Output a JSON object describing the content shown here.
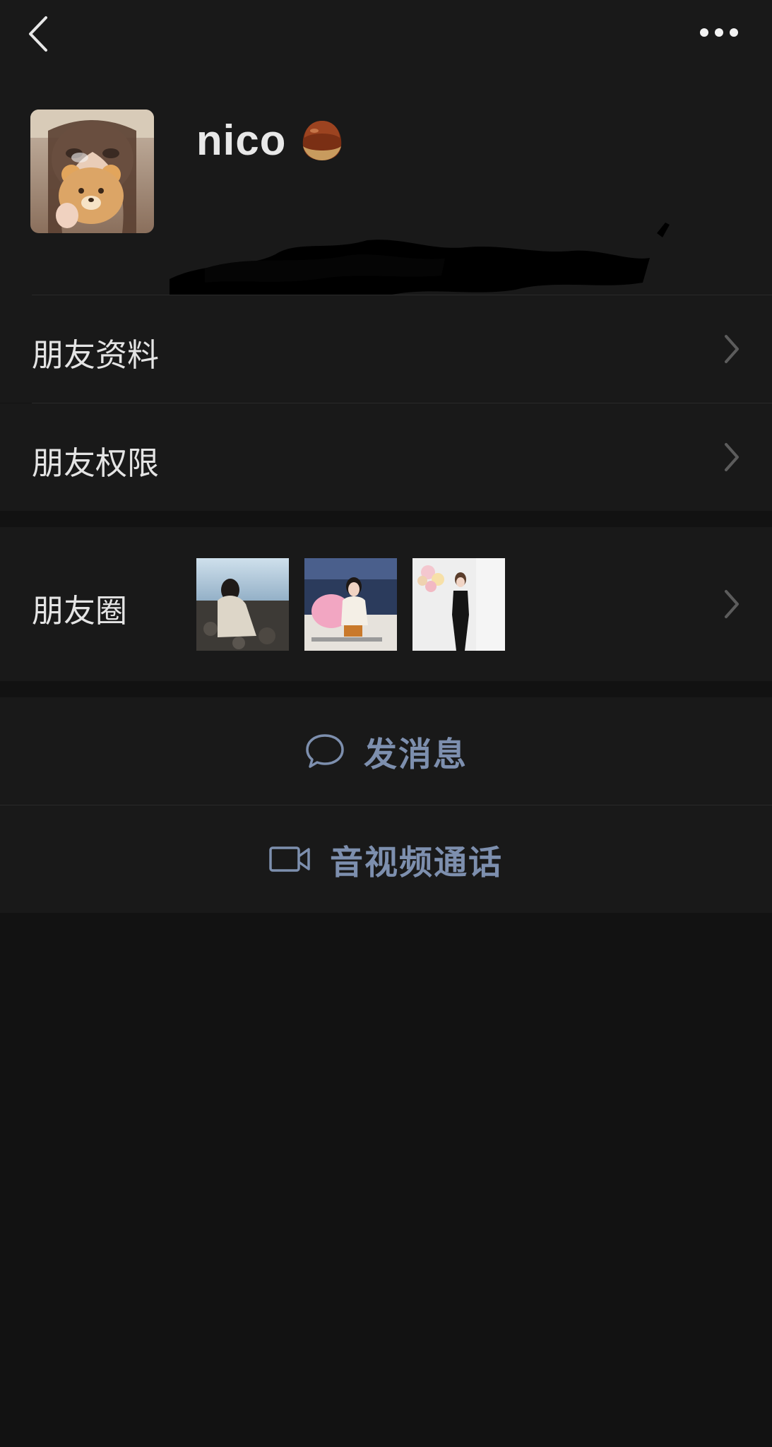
{
  "profile": {
    "nickname": "nico"
  },
  "menu": {
    "friend_info": "朋友资料",
    "friend_permissions": "朋友权限",
    "moments": "朋友圈"
  },
  "actions": {
    "send_message": "发消息",
    "video_call": "音视频通话"
  },
  "colors": {
    "background": "#121212",
    "card": "#191919",
    "action_text": "#7d8fae",
    "text": "#e4e4e4"
  },
  "icons": {
    "back": "chevron-left-icon",
    "more": "ellipsis-icon",
    "chevron": "chevron-right-icon",
    "message": "chat-bubble-icon",
    "video": "video-camera-icon"
  }
}
